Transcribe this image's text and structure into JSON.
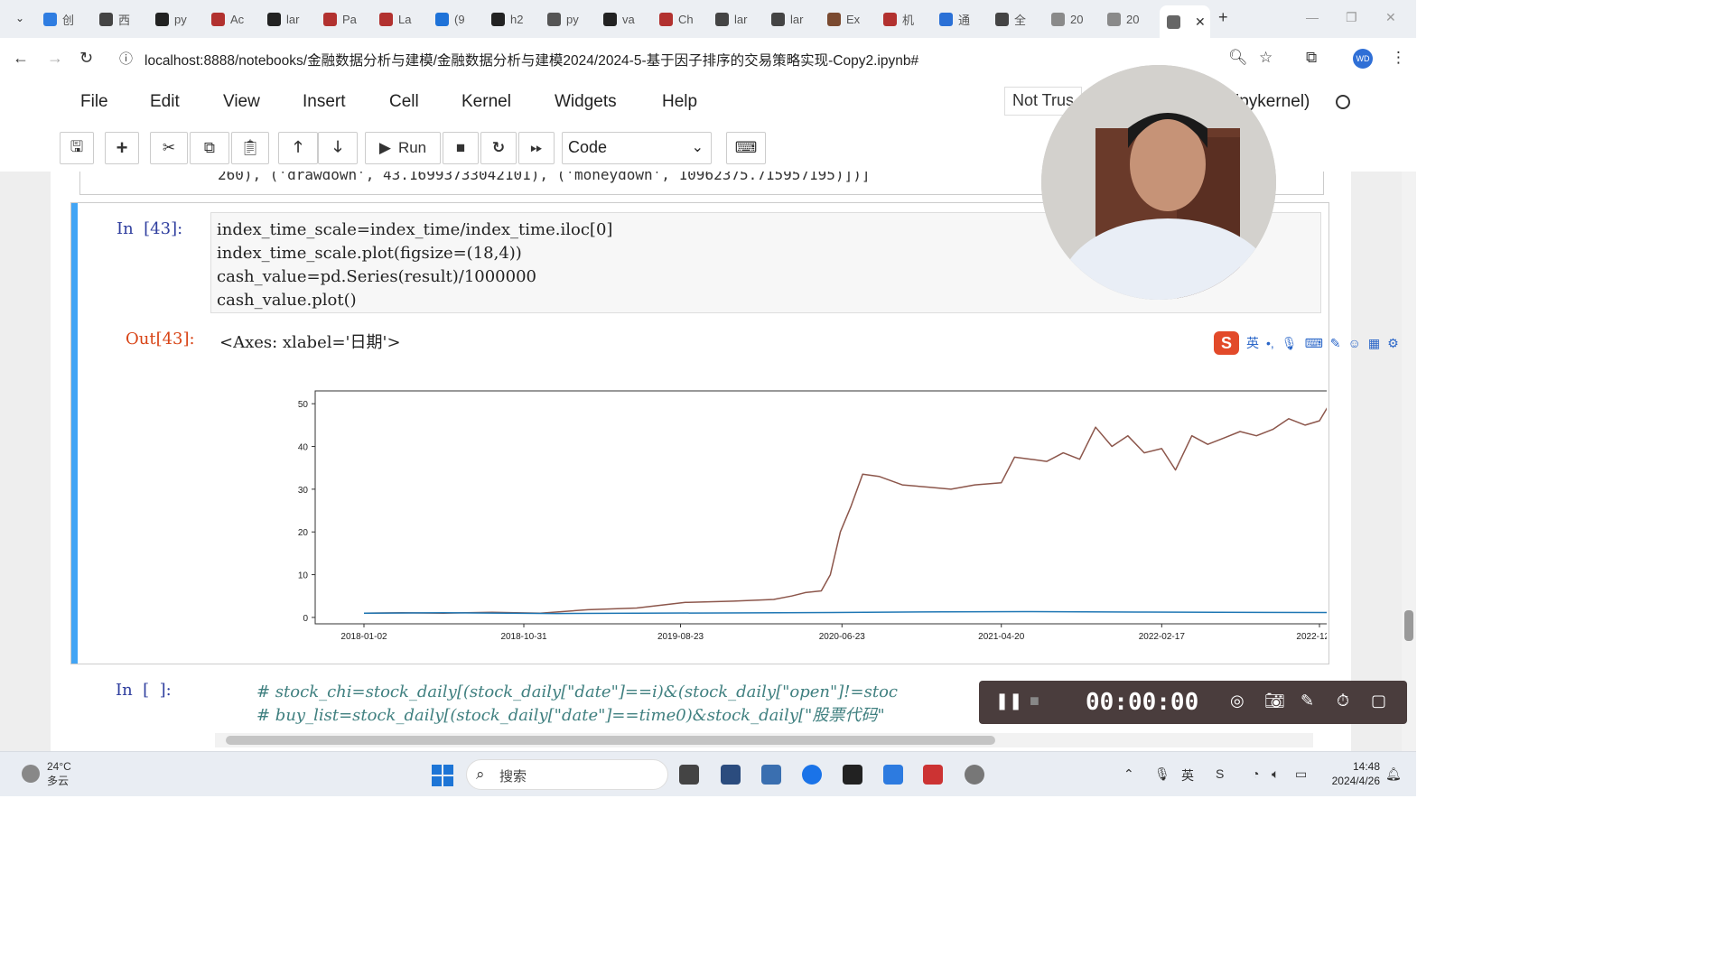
{
  "browser": {
    "tabs": [
      {
        "label": "创",
        "color": "#2f7de1"
      },
      {
        "label": "西",
        "color": "#444444"
      },
      {
        "label": "py",
        "color": "#222222"
      },
      {
        "label": "Ac",
        "color": "#b2312f"
      },
      {
        "label": "lar",
        "color": "#222222"
      },
      {
        "label": "Pa",
        "color": "#b2312f"
      },
      {
        "label": "La",
        "color": "#b2312f"
      },
      {
        "label": "(9",
        "color": "#1e72d8"
      },
      {
        "label": "h2",
        "color": "#222222"
      },
      {
        "label": "py",
        "color": "#555555"
      },
      {
        "label": "va",
        "color": "#222222"
      },
      {
        "label": "Ch",
        "color": "#b2312f"
      },
      {
        "label": "lar",
        "color": "#444444"
      },
      {
        "label": "lar",
        "color": "#444444"
      },
      {
        "label": "Ex",
        "color": "#7a4a30"
      },
      {
        "label": "机",
        "color": "#b2312f"
      },
      {
        "label": "通",
        "color": "#2a70d6"
      },
      {
        "label": "全",
        "color": "#444444"
      },
      {
        "label": "20",
        "color": "#8a8a8a"
      },
      {
        "label": "20",
        "color": "#8a8a8a"
      }
    ],
    "active_tab_close": "✕",
    "new_tab": "+",
    "url": "localhost:8888/notebooks/金融数据分析与建模/金融数据分析与建模2024/2024-5-基于因子排序的交易策略实现-Copy2.ipynb#",
    "profile_initials": "WD"
  },
  "menu": {
    "items": [
      "File",
      "Edit",
      "View",
      "Insert",
      "Cell",
      "Kernel",
      "Widgets",
      "Help"
    ],
    "trust": "Not Trus",
    "kernel": "ipykernel)"
  },
  "toolbar": {
    "run_label": "Run",
    "cell_type": "Code"
  },
  "prev_output": "260), ('drawdown', 43.16993733042101), ('moneydown', 10962375.715957195)])]",
  "cell43": {
    "in_prompt": "In  [43]:",
    "code_lines": [
      "index_time_scale=index_time/index_time.iloc[0]",
      "index_time_scale.plot(figsize=(18,4))",
      "cash_value=pd.Series(result)/1000000",
      "cash_value.plot()"
    ],
    "out_prompt": "Out[43]:",
    "out_text": "<Axes: xlabel='日期'>"
  },
  "chart_data": {
    "type": "line",
    "xlabel": "日期",
    "x_ticks": [
      "2018-01-02",
      "2018-10-31",
      "2019-08-23",
      "2020-06-23",
      "2021-04-20",
      "2022-02-17",
      "2022-12-12"
    ],
    "y_ticks": [
      0,
      10,
      20,
      30,
      40,
      50
    ],
    "ylim": [
      -1.5,
      53
    ],
    "grid": false,
    "series": [
      {
        "color": "#8c564b",
        "x": [
          "2018-01-02",
          "2018-03-15",
          "2018-06-01",
          "2018-09-01",
          "2018-12-01",
          "2019-03-01",
          "2019-06-01",
          "2019-09-01",
          "2019-12-01",
          "2020-02-15",
          "2020-03-20",
          "2020-04-15",
          "2020-05-15",
          "2020-06-01",
          "2020-06-20",
          "2020-07-10",
          "2020-08-01",
          "2020-09-01",
          "2020-10-15",
          "2020-12-01",
          "2021-01-15",
          "2021-03-01",
          "2021-04-20",
          "2021-05-15",
          "2021-06-15",
          "2021-07-15",
          "2021-08-15",
          "2021-09-15",
          "2021-10-15",
          "2021-11-15",
          "2021-12-15",
          "2022-01-15",
          "2022-02-17",
          "2022-03-15",
          "2022-04-15",
          "2022-05-15",
          "2022-06-15",
          "2022-07-15",
          "2022-08-15",
          "2022-09-15",
          "2022-10-15",
          "2022-11-15",
          "2022-12-12",
          "2023-01-05",
          "2023-01-25",
          "2023-02-10"
        ],
        "y": [
          1.0,
          1.1,
          1.0,
          1.2,
          1.0,
          1.8,
          2.2,
          3.5,
          3.8,
          4.2,
          5.0,
          5.8,
          6.2,
          10.0,
          20.0,
          26.0,
          33.5,
          33.0,
          31.0,
          30.5,
          30.0,
          31.0,
          31.5,
          37.5,
          37.0,
          36.5,
          38.5,
          37.0,
          44.5,
          40.0,
          42.5,
          38.5,
          39.5,
          34.5,
          42.5,
          40.5,
          42.0,
          43.5,
          42.5,
          44.0,
          46.5,
          45.0,
          46.0,
          51.0,
          50.0,
          51.5
        ]
      },
      {
        "color": "#1f77b4",
        "x": [
          "2018-01-02",
          "2018-06-01",
          "2019-01-01",
          "2019-06-01",
          "2020-01-01",
          "2020-06-01",
          "2021-01-01",
          "2021-06-01",
          "2022-01-01",
          "2022-06-01",
          "2023-01-01",
          "2023-02-10"
        ],
        "y": [
          1.0,
          1.1,
          0.9,
          1.0,
          1.05,
          1.15,
          1.3,
          1.35,
          1.25,
          1.2,
          1.15,
          1.2
        ]
      }
    ]
  },
  "cell_next": {
    "in_prompt": "In  [  ]:",
    "code_lines": [
      "# stock_chi=stock_daily[(stock_daily[\"date\"]==i)&(stock_daily[\"open\"]!=stoc",
      "# buy_list=stock_daily[(stock_daily[\"date\"]==time0)&stock_daily[\"股票代码\""
    ]
  },
  "ime": {
    "logo": "S",
    "lang": "英",
    "punct": "•,"
  },
  "recorder": {
    "time": "00:00:00"
  },
  "taskbar": {
    "temperature": "24°C",
    "weather": "多云",
    "search": "搜索",
    "time": "14:48",
    "date": "2024/4/26"
  }
}
